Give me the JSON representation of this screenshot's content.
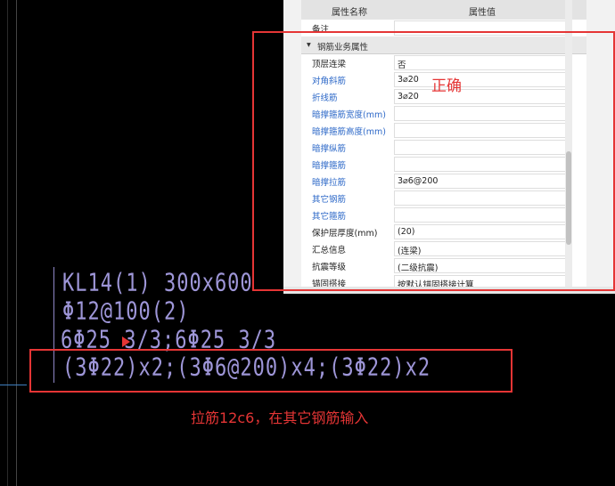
{
  "property_panel": {
    "header": {
      "name_col": "属性名称",
      "value_col": "属性值"
    },
    "top_row": {
      "name": "备注",
      "value": ""
    },
    "group": {
      "toggle": "▾",
      "title": "钢筋业务属性"
    },
    "rows": [
      {
        "name": "顶层连梁",
        "value": "否",
        "blue": false
      },
      {
        "name": "对角斜筋",
        "value": "3⌀20",
        "blue": true
      },
      {
        "name": "折线筋",
        "value": "3⌀20",
        "blue": true
      },
      {
        "name": "暗撑箍筋宽度(mm)",
        "value": "",
        "blue": true
      },
      {
        "name": "暗撑箍筋高度(mm)",
        "value": "",
        "blue": true
      },
      {
        "name": "暗撑纵筋",
        "value": "",
        "blue": true
      },
      {
        "name": "暗撑箍筋",
        "value": "",
        "blue": true
      },
      {
        "name": "暗撑拉筋",
        "value": "3⌀6@200",
        "blue": true
      },
      {
        "name": "其它钢筋",
        "value": "",
        "blue": true
      },
      {
        "name": "其它箍筋",
        "value": "",
        "blue": true
      },
      {
        "name": "保护层厚度(mm)",
        "value": "(20)",
        "blue": false
      },
      {
        "name": "汇总信息",
        "value": "(连梁)",
        "blue": false
      },
      {
        "name": "抗震等级",
        "value": "(二级抗震)",
        "blue": false
      },
      {
        "name": "锚固搭接",
        "value": "按默认锚固搭接计算",
        "blue": false
      }
    ]
  },
  "annotations": {
    "correct_label": "正确",
    "tie_note": "拉筋12c6，在其它钢筋输入"
  },
  "cad_text": {
    "line1": "KL14(1) 300x600",
    "line2": "Φ12@100(2)",
    "line3": "6Φ25 3/3;6Φ25 3/3",
    "line4": "(3Φ22)x2;(3Φ6@200)x4;(3Φ22)x2"
  },
  "colors": {
    "annotation_red": "#e53535",
    "cad_text": "#9e96d8",
    "link_blue": "#2e69c8"
  }
}
